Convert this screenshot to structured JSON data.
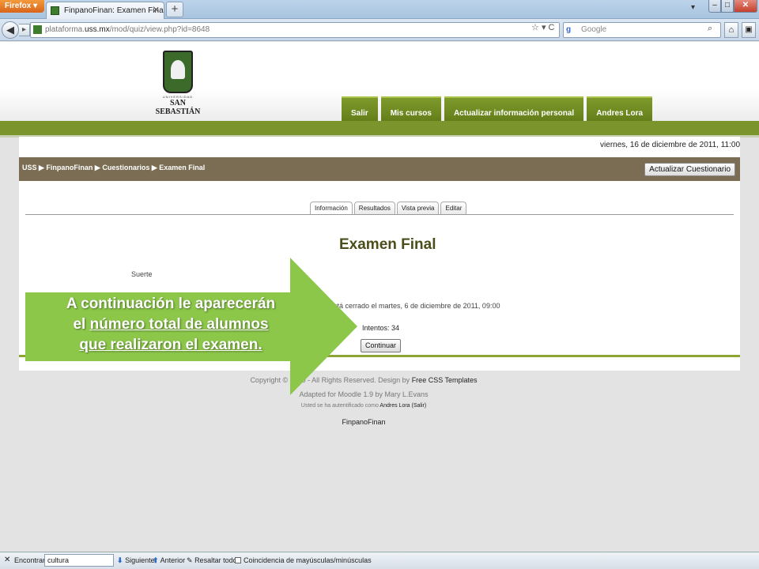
{
  "browser": {
    "app_button": "Firefox",
    "tab_title": "FinpanoFinan: Examen Final",
    "url_host": "plataforma.uss.mx",
    "url_prefix": "plataforma.",
    "url_domain": "uss.mx",
    "url_path": "/mod/quiz/view.php?id=8648",
    "search_placeholder": "Google"
  },
  "site": {
    "logo_line1": "UNIVERSIDAD",
    "logo_line2": "SAN SEBASTIÁN",
    "nav": [
      "Salir",
      "Mis cursos",
      "Actualizar información personal",
      "Andres Lora"
    ],
    "date": "viernes, 16 de diciembre de 2011, 11:00",
    "breadcrumb": "USS ▶ FinpanoFinan ▶ Cuestionarios ▶ Examen Final",
    "update_button": "Actualizar Cuestionario",
    "quiz_tabs": [
      "Información",
      "Resultados",
      "Vista previa",
      "Editar"
    ],
    "quiz_title": "Examen Final",
    "intro": "Suerte",
    "closed_text": "stá cerrado el martes, 6 de diciembre de 2011, 09:00",
    "attempts": "Intentos: 34",
    "continue_button": "Continuar"
  },
  "footer": {
    "copyright": "Copyright © 2010 - All Rights Reserved. Design by",
    "design_link": "Free CSS Templates",
    "adapted": "Adapted for Moodle 1.9 by Mary L.Evans",
    "auth_prefix": "Usted se ha autentificado como",
    "auth_user": "Andres Lora",
    "auth_logout": "(Salir)",
    "course_link": "FinpanoFinan"
  },
  "callout": {
    "line1": "A continuación le aparecerán",
    "line2_pre": "el ",
    "line2_u": "número total de alumnos",
    "line3": "que realizaron el examen.",
    "color": "#8cc74a"
  },
  "findbar": {
    "label": "Encontrar:",
    "query": "cultura",
    "next": "Siguiente",
    "prev": "Anterior",
    "highlight": "Resaltar todo",
    "match_case": "Coincidencia de mayúsculas/minúsculas"
  }
}
